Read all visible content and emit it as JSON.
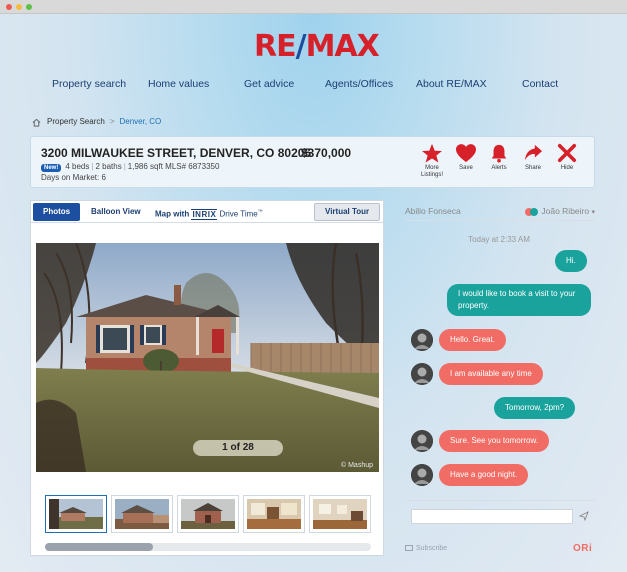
{
  "brand": {
    "logo_left": "RE",
    "logo_slash": "/",
    "logo_right": "MAX",
    "logo_color": "#d7212a",
    "slash_color": "#1b4f9c"
  },
  "nav": [
    "Property search",
    "Home values",
    "Get advice",
    "Agents/Offices",
    "About RE/MAX",
    "Contact"
  ],
  "breadcrumb": {
    "home_icon": "home-icon",
    "item1": "Property Search",
    "separator": ">",
    "item2": "Denver, CO"
  },
  "listing": {
    "address": "3200 MILWAUKEE STREET, DENVER, CO 80205",
    "price": "$370,000",
    "badge": "New!",
    "beds": "4 beds",
    "baths": "2 baths",
    "sqft": "1,986 sqft",
    "mls": "MLS# 6873350",
    "days_on_market": "Days on Market: 6",
    "actions": [
      {
        "icon": "star-icon",
        "label1": "More",
        "label2": "Listings!"
      },
      {
        "icon": "heart-icon",
        "label1": "Save",
        "label2": ""
      },
      {
        "icon": "bell-icon",
        "label1": "Alerts",
        "label2": ""
      },
      {
        "icon": "share-icon",
        "label1": "Share",
        "label2": ""
      },
      {
        "icon": "close-icon",
        "label1": "Hide",
        "label2": ""
      }
    ],
    "accent": "#d7212a"
  },
  "media": {
    "tabs": {
      "photos": "Photos",
      "balloon": "Balloon View",
      "map_with": "Map with",
      "inrix": "INRIX",
      "drive_time": "Drive Time",
      "tm": "™",
      "virtual_tour": "Virtual Tour"
    },
    "counter": "1 of 28",
    "thumbnail_count": 5,
    "scroll_fraction": 0.33
  },
  "chat": {
    "agent": "Abilio Fonseca",
    "user": "João Ribeiro",
    "time": "Today at 2:33 AM",
    "messages": [
      {
        "from": "me",
        "text": "Hi."
      },
      {
        "from": "me",
        "text": "I would like to book a visit to your property."
      },
      {
        "from": "them",
        "text": "Hello. Great."
      },
      {
        "from": "them",
        "text": "I am available any time"
      },
      {
        "from": "me",
        "text": "Tomorrow, 2pm?"
      },
      {
        "from": "them",
        "text": "Sure. See you tomorrow."
      },
      {
        "from": "them",
        "text": "Have a good night."
      }
    ],
    "input_placeholder": "",
    "subscribe": "Subscribe",
    "ori": "ORi",
    "me_color": "#1aa29c",
    "them_color": "#f16c64"
  }
}
